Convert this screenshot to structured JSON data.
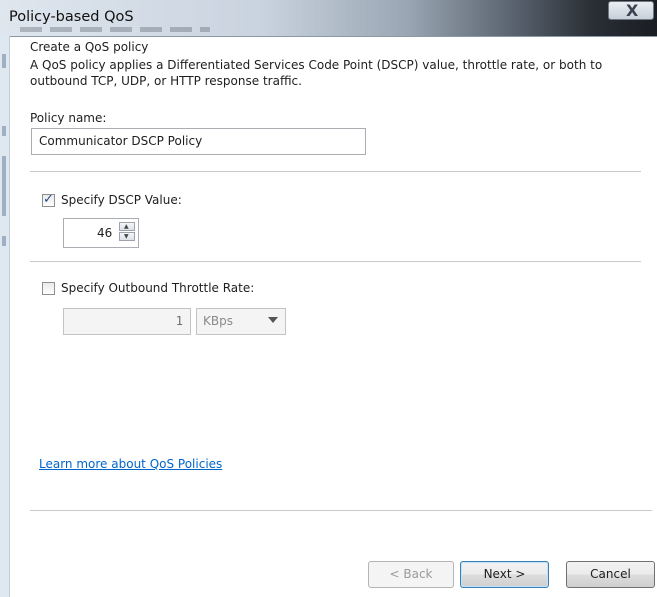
{
  "window": {
    "title": "Policy-based QoS",
    "close_glyph": "X"
  },
  "page": {
    "heading": "Create a QoS policy",
    "description": "A QoS policy applies a Differentiated Services Code Point (DSCP) value, throttle rate, or both to outbound TCP, UDP, or HTTP response traffic.",
    "policy_name_label": "Policy name:",
    "policy_name_value": "Communicator DSCP Policy"
  },
  "dscp": {
    "label": "Specify DSCP Value:",
    "checked": true,
    "value": "46"
  },
  "throttle": {
    "label": "Specify Outbound Throttle Rate:",
    "checked": false,
    "value": "1",
    "unit": "KBps"
  },
  "link": "Learn more about QoS Policies",
  "buttons": {
    "back": "< Back",
    "next": "Next >",
    "cancel": "Cancel"
  },
  "colors": {
    "link": "#0066cc",
    "checkmark": "#2a4a8c",
    "default_button_border": "#3c7fb1"
  }
}
